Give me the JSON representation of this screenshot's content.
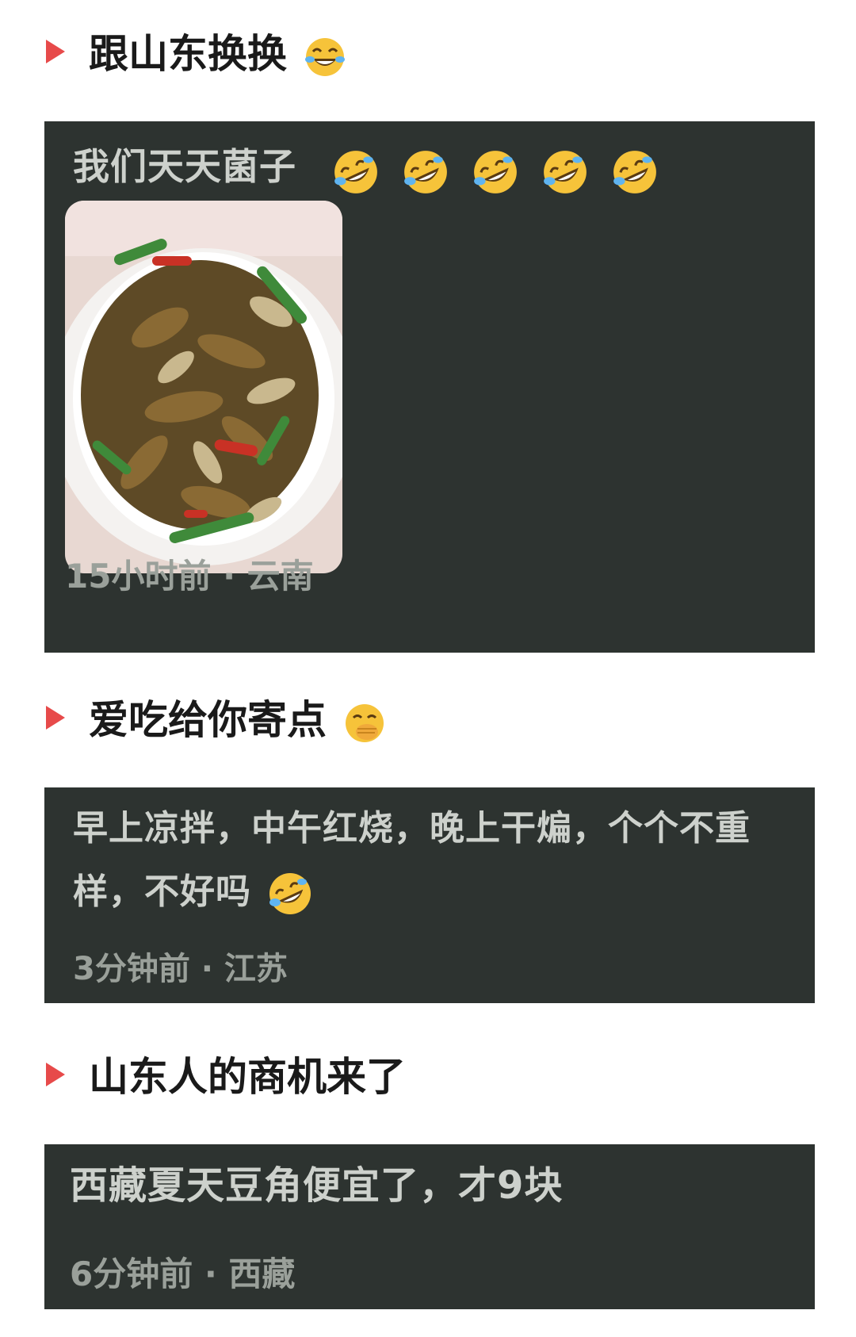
{
  "posts": [
    {
      "heading": "跟山东换换",
      "heading_emoji": "laughing-tears-emoji-icon",
      "comment_text": "我们天天菌子",
      "comment_emoji_count": 5,
      "comment_emoji": "rofl-emoji-icon",
      "meta": "15小时前 · 云南"
    },
    {
      "heading": "爱吃给你寄点",
      "heading_emoji": "hand-over-mouth-emoji-icon",
      "comment_text": "早上凉拌，中午红烧，晚上干煸，个个不重样，不好吗",
      "comment_emoji": "rofl-emoji-icon",
      "meta": "3分钟前 · 江苏"
    },
    {
      "heading": "山东人的商机来了",
      "comment_text": "西藏夏天豆角便宜了，才9块",
      "meta": "6分钟前 · 西藏"
    }
  ],
  "colors": {
    "arrow": "#e74a4a",
    "card_bg": "#2d3330",
    "card_text": "#cdd1cc",
    "meta_text": "#9aa09a"
  }
}
